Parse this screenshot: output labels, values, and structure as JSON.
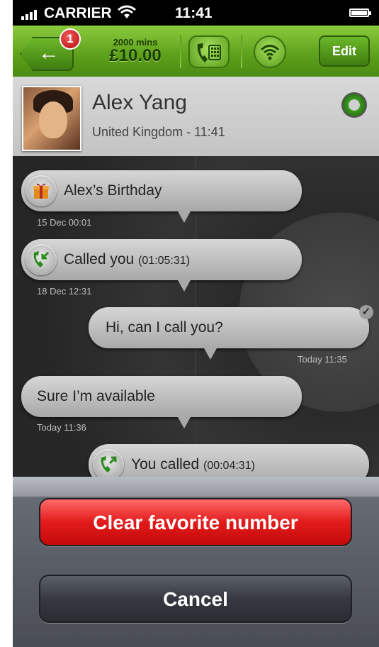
{
  "status_bar": {
    "carrier": "CARRIER",
    "time": "11:41"
  },
  "toolbar": {
    "badge_count": "1",
    "minutes": "2000 mins",
    "balance": "£10.00",
    "edit_label": "Edit",
    "back_icon": "back-arrow-icon",
    "dialpad_icon": "phone-dialpad-icon",
    "wifi_icon": "wifi-call-icon"
  },
  "contact": {
    "name": "Alex Yang",
    "location": "United Kingdom - 11:41",
    "presence": "online"
  },
  "messages": [
    {
      "text": "Alex’s Birthday",
      "detail": "",
      "time": "15 Dec 00:01",
      "icon": "gift-icon",
      "side": "left"
    },
    {
      "text": "Called you",
      "detail": "(01:05:31)",
      "time": "18 Dec 12:31",
      "icon": "incoming-call-icon",
      "side": "left"
    },
    {
      "text": "Hi, can I call you?",
      "detail": "",
      "time": "Today 11:35",
      "icon": "",
      "side": "right",
      "delivered": true
    },
    {
      "text": "Sure I’m available",
      "detail": "",
      "time": "Today 11:36",
      "icon": "",
      "side": "left"
    },
    {
      "text": "You called",
      "detail": "(00:04:31)",
      "time": "",
      "icon": "outgoing-call-icon",
      "side": "right"
    }
  ],
  "action_sheet": {
    "clear_label": "Clear favorite number",
    "cancel_label": "Cancel"
  },
  "colors": {
    "toolbar_green": "#5fa21c",
    "destructive_red": "#e21b1b",
    "cancel_dark": "#363940"
  }
}
